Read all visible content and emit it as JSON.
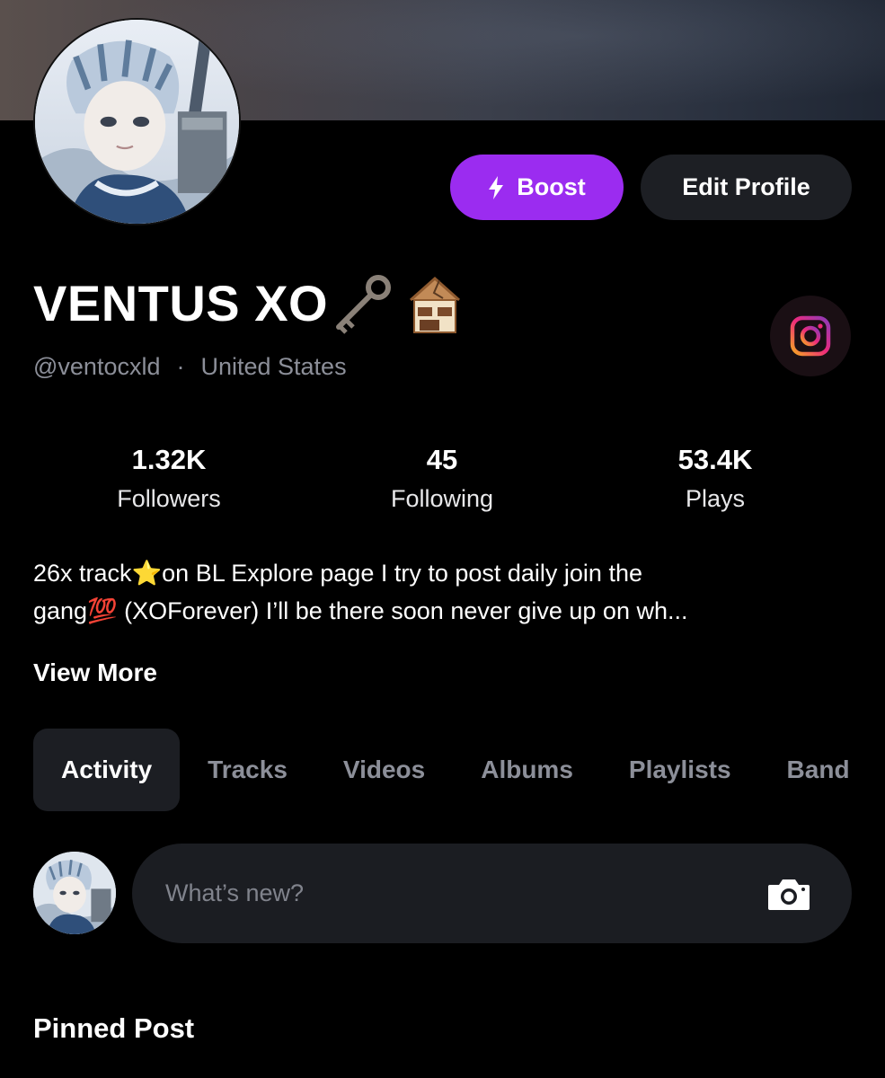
{
  "profile": {
    "display_name": "VENTUS XO",
    "name_emojis": [
      "🗝️",
      "🏚️"
    ],
    "handle": "@ventocxld",
    "separator": "·",
    "location": "United States"
  },
  "actions": {
    "boost_label": "Boost",
    "edit_label": "Edit Profile"
  },
  "social": {
    "icon": "instagram-icon"
  },
  "stats": [
    {
      "value": "1.32K",
      "label": "Followers"
    },
    {
      "value": "45",
      "label": "Following"
    },
    {
      "value": "53.4K",
      "label": "Plays"
    }
  ],
  "bio": {
    "line1": "26x track⭐️on BL Explore page I try to post daily  join the",
    "line2": "gang💯 (XOForever) I’ll be there  soon never give up on wh...",
    "view_more": "View More"
  },
  "tabs": [
    {
      "label": "Activity",
      "active": true
    },
    {
      "label": "Tracks",
      "active": false
    },
    {
      "label": "Videos",
      "active": false
    },
    {
      "label": "Albums",
      "active": false
    },
    {
      "label": "Playlists",
      "active": false
    },
    {
      "label": "Band",
      "active": false
    }
  ],
  "composer": {
    "placeholder": "What’s new?",
    "camera_icon": "camera-icon"
  },
  "sections": {
    "pinned_title": "Pinned Post"
  },
  "colors": {
    "accent": "#9b2cf0",
    "background": "#000000",
    "muted_text": "#8c8f99",
    "surface": "#1c1e23"
  }
}
